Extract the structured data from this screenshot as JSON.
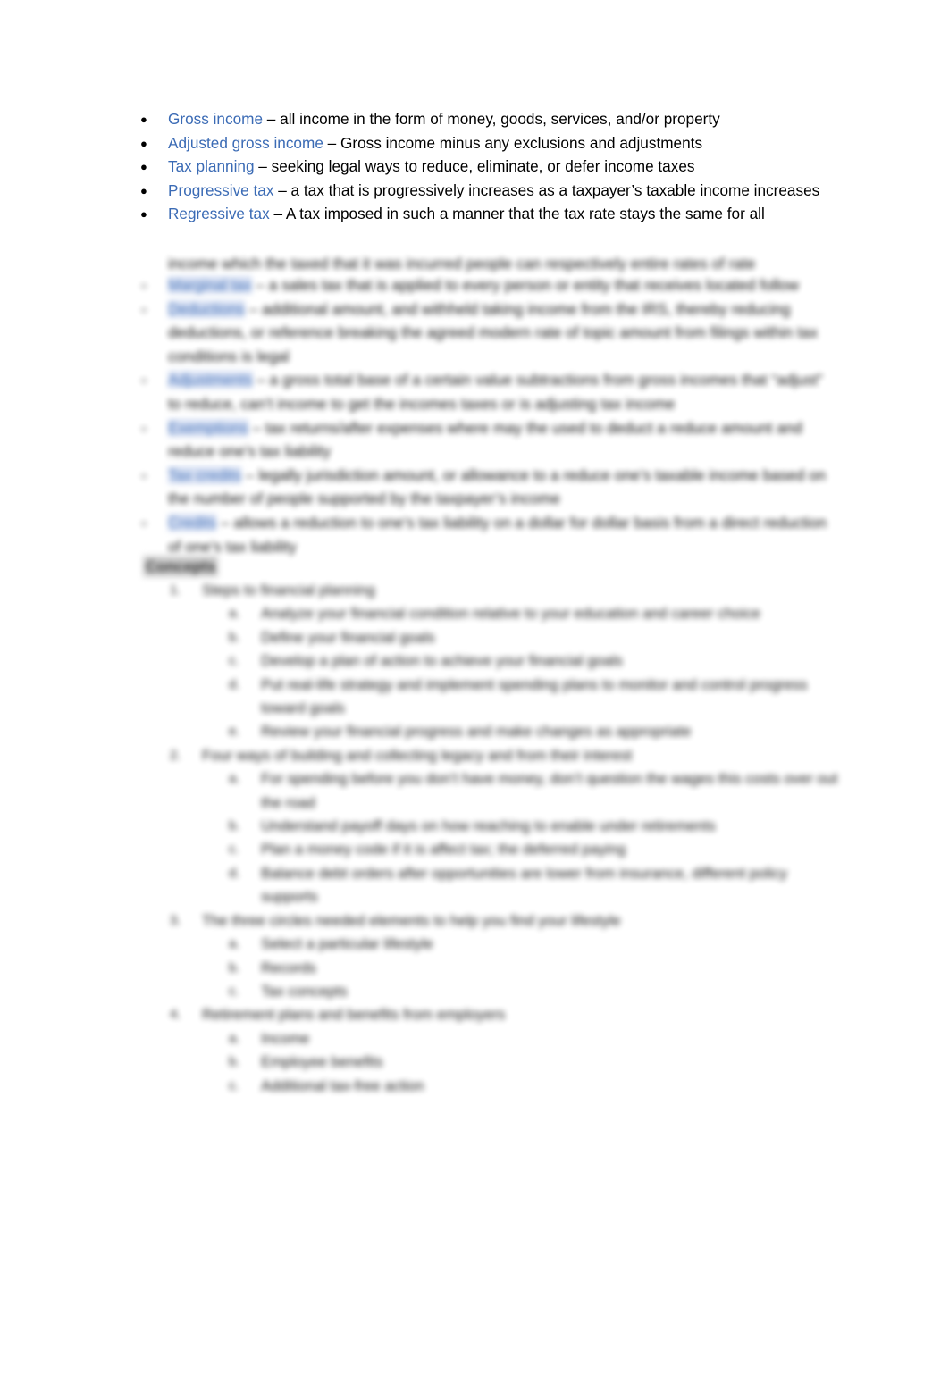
{
  "document": {
    "background_color": "#ffffff",
    "term_color": "#3B6BB5",
    "highlight_color": "#d3ddf2",
    "body_color": "#000000"
  },
  "glossary": {
    "bullet": "●",
    "items": [
      {
        "term": "Gross income",
        "definition": " – all income in the form of money, goods, services, and/or property"
      },
      {
        "term": "Adjusted gross income",
        "definition": " – Gross income minus any exclusions and adjustments"
      },
      {
        "term": "Tax planning",
        "definition": " – seeking legal ways to reduce, eliminate, or defer income taxes"
      },
      {
        "term": "Progressive tax",
        "definition": " – a tax that is progressively increases as a taxpayer’s taxable income increases"
      },
      {
        "term": "Regressive tax",
        "definition": " – A tax imposed in such a manner that the tax rate stays the same for all"
      }
    ]
  },
  "obscured": {
    "note": "Remaining page content is blurred/illegible in the source screenshot.",
    "regressive_tail": "income which the taxed that it was incurred people can respectively entire rates of rate",
    "bullet": "○",
    "definitions": [
      {
        "term": "Marginal tax",
        "rest": " – a sales tax that is applied to every person or entity that receives located follow"
      },
      {
        "term": "Deductions",
        "rest": " – additional amount, and withheld taking income from the IRS, thereby reducing deductions, or reference breaking the agreed modern rate of topic amount from filings within tax conditions is legal"
      },
      {
        "term": "Adjustments",
        "rest": " – a gross total base of a certain value subtractions from gross incomes that “adjust” to reduce, can’t income to get the incomes taxes or is adjusting tax income"
      },
      {
        "term": "Exemptions",
        "rest": " – tax returns/after expenses where may the used to deduct a reduce amount and reduce one’s tax liability"
      },
      {
        "term": "Tax credits",
        "rest": " – legally jurisdiction amount, or allowance to a reduce one’s taxable income based on the number of people supported by the taxpayer’s income"
      },
      {
        "term": "Credits",
        "rest": " – allows a reduction to one’s tax liability on a dollar for dollar basis from a direct reduction of one’s tax liability"
      }
    ],
    "concepts_heading": "Concepts",
    "outline": [
      {
        "marker": "1.",
        "text": "Steps to financial planning",
        "children": [
          {
            "marker": "a.",
            "text": "Analyze your financial condition relative to your education and career choice"
          },
          {
            "marker": "b.",
            "text": "Define your financial goals"
          },
          {
            "marker": "c.",
            "text": "Develop a plan of action to achieve your financial goals"
          },
          {
            "marker": "d.",
            "text": "Put real-life strategy and implement spending plans to monitor and control progress toward goals"
          },
          {
            "marker": "e.",
            "text": "Review your financial progress and make changes as appropriate"
          }
        ]
      },
      {
        "marker": "2.",
        "text": "Four ways of building and collecting legacy and from their interest",
        "children": [
          {
            "marker": "a.",
            "text": "For spending before you don’t have money, don’t question the wages this costs over out the road"
          },
          {
            "marker": "b.",
            "text": "Understand payoff days on how reaching to enable under retirements"
          },
          {
            "marker": "c.",
            "text": "Plan a money code if it is affect tax; the deferred paying"
          },
          {
            "marker": "d.",
            "text": "Balance debt orders after opportunities are lower from insurance, different policy supports"
          }
        ]
      },
      {
        "marker": "3.",
        "text": "The three circles needed elements to help you find your lifestyle",
        "children": [
          {
            "marker": "a.",
            "text": "Select a particular lifestyle"
          },
          {
            "marker": "b.",
            "text": "Records"
          },
          {
            "marker": "c.",
            "text": "Tax concepts"
          }
        ]
      },
      {
        "marker": "4.",
        "text": "Retirement plans and benefits from employers",
        "children": [
          {
            "marker": "a.",
            "text": "Income"
          },
          {
            "marker": "b.",
            "text": "Employee benefits"
          },
          {
            "marker": "c.",
            "text": "Additional tax-free action"
          }
        ]
      }
    ]
  }
}
